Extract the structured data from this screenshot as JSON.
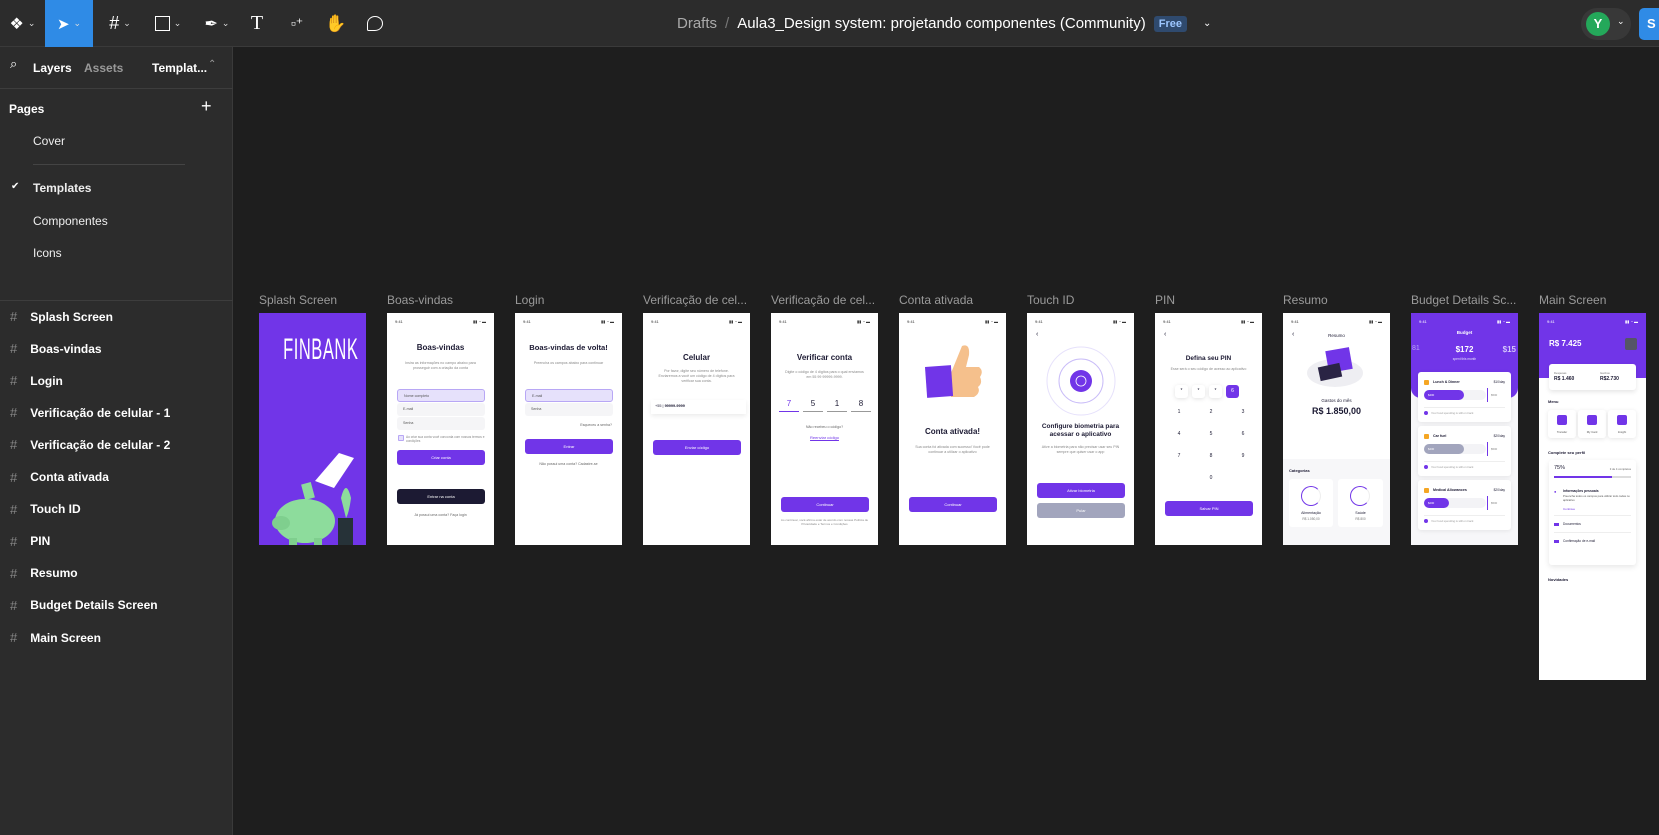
{
  "toolbar": {
    "tools": [
      "figma-menu",
      "move",
      "frame",
      "shape",
      "pen",
      "text",
      "resources",
      "hand",
      "comment"
    ],
    "accent": "#2f8be6"
  },
  "header": {
    "breadcrumb": "Drafts",
    "separator": "/",
    "file_title": "Aula3_Design system: projetando componentes (Community)",
    "plan_badge": "Free",
    "avatar_initial": "Y",
    "share_label": "S"
  },
  "sidebar": {
    "tabs": {
      "layers": "Layers",
      "assets": "Assets",
      "page_selector": "Templat..."
    },
    "pages_heading": "Pages",
    "pages": [
      {
        "label": "Cover"
      },
      {
        "label": "Templates",
        "selected": true
      },
      {
        "label": "Componentes"
      },
      {
        "label": "Icons"
      }
    ],
    "layers": [
      "Splash Screen",
      "Boas-vindas",
      "Login",
      "Verificação de celular - 1",
      "Verificação de celular - 2",
      "Conta ativada",
      "Touch ID",
      "PIN",
      "Resumo",
      "Budget Details Screen",
      "Main Screen"
    ]
  },
  "canvas": {
    "frame_labels": [
      "Splash Screen",
      "Boas-vindas",
      "Login",
      "Verificação de cel...",
      "Verificação de cel...",
      "Conta ativada",
      "Touch ID",
      "PIN",
      "Resumo",
      "Budget Details Sc...",
      "Main Screen"
    ],
    "brand_color": "#7135e8"
  },
  "screens": {
    "time": "9:41",
    "splash": {
      "logo": "FINBANK"
    },
    "boas": {
      "title": "Boas-vindas",
      "subtitle": "Insira as informações no campo abaixo para prosseguir com a criação da conta",
      "name": "Nome completo",
      "email": "E-mail",
      "password": "Senha",
      "terms": "Ao criar sua conta você concorda com nossos termos e condições",
      "create": "Criar conta",
      "enter": "Entrar na conta",
      "footer": "Já possui uma conta? Faça login"
    },
    "login": {
      "title": "Boas-vindas de volta!",
      "subtitle": "Preencha os campos abaixo para continuar",
      "email": "E-mail",
      "password": "Senha",
      "forgot": "Esqueceu a senha?",
      "enter": "Entrar",
      "footer": "Não possui uma conta? Cadastre-se"
    },
    "cel1": {
      "title": "Celular",
      "subtitle": "Por favor, digite seu número de telefone. Enviaremos a você um código de 4 dígitos para verificar sua conta.",
      "code": "+55",
      "phone": "99999-9999",
      "button": "Enviar código"
    },
    "cel2": {
      "title": "Verificar conta",
      "subtitle": "Digite o código de 4 dígitos para o qual enviamos em 55 99 99999-9999.",
      "digits": [
        "7",
        "5",
        "1",
        "8"
      ],
      "not_received": "Não recebeu o código?",
      "resend": "Reenviar código",
      "button": "Continuar",
      "footer": "Ao continuar, você afirma estar de acordo com nossas Política de Privacidade e Termos e Condições"
    },
    "conta": {
      "title": "Conta ativada!",
      "subtitle": "Sua conta foi ativada com sucesso! Você pode continuar a utilizar o aplicativo",
      "button": "Continuar"
    },
    "touch": {
      "title": "Configure biometria para acessar o aplicativo",
      "subtitle": "Ative a biometria para não precisar usar seu PIN sempre que quiser usar o app",
      "activate": "Ativar biometria",
      "skip": "Pular"
    },
    "pin": {
      "title": "Defina seu PIN",
      "subtitle": "Esse será o seu código de acesso ao aplicativo",
      "entered": [
        "*",
        "*",
        "*",
        "6"
      ],
      "keys": [
        "1",
        "2",
        "3",
        "4",
        "5",
        "6",
        "7",
        "8",
        "9",
        "0"
      ],
      "button": "Salvar PIN"
    },
    "resumo": {
      "title": "Resumo",
      "label": "Gastos do mês",
      "amount": "R$ 1.850,00",
      "categories": "Categorias",
      "cards": [
        {
          "name": "Alimentação",
          "value": "R$ 1.050,00"
        },
        {
          "name": "Saúde",
          "value": "R$ 800"
        }
      ]
    },
    "budget": {
      "title": "Budget",
      "left": "81",
      "amount": "$172",
      "right": "$15",
      "caption": "spent this month",
      "items": [
        {
          "name": "Lunch & Dinner",
          "rate": "$10/day",
          "spent": "$400",
          "limit": "$500",
          "progress": 0.65
        },
        {
          "name": "Car fuel",
          "rate": "$20/day",
          "spent": "$400",
          "limit": "$500",
          "progress": 0.65
        },
        {
          "name": "Medical Allowances",
          "rate": "$20/day",
          "spent": "$200",
          "limit": "$500",
          "progress": 0.4
        }
      ],
      "note": "Your food spending is still on track"
    },
    "main": {
      "balance": "R$ 7.425",
      "expense_label": "Despesas",
      "expense": "R$ 1.460",
      "income_label": "Ganhos",
      "income": "R$2.730",
      "menu": "Menu",
      "menu_items": [
        "Transfer",
        "My Card",
        "Insight"
      ],
      "profile": "Complete seu perfil",
      "percent": "75%",
      "steps": "3 de 4 completos",
      "progress": 0.75,
      "personal": "Informações pessoais",
      "personal_desc": "Preencha todos os campos para utilizar todo todas no aplicativo",
      "continue": "Continue",
      "docs": "Documentos",
      "email": "Confirmação de e-mail",
      "news": "Novidades"
    }
  }
}
